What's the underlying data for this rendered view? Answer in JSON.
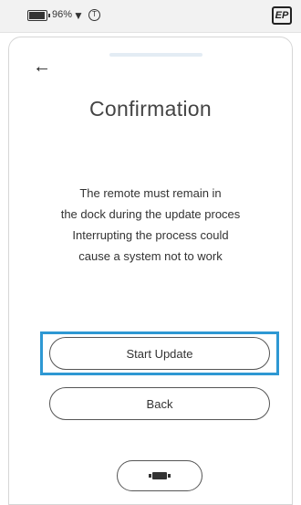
{
  "status_bar": {
    "battery_percent": "96%",
    "battery_icon": "battery-icon",
    "wifi_icon": "wifi-icon",
    "circle_icon": "circle-t-icon",
    "logo_text": "EP"
  },
  "screen": {
    "back_icon": "back-arrow-icon",
    "title": "Confirmation",
    "message_lines": [
      "The remote must remain in",
      "the dock during the update proces",
      "Interrupting the process could",
      "cause a system not to work"
    ],
    "start_button": "Start Update",
    "back_button": "Back",
    "dock_icon": "remote-dock-icon"
  },
  "colors": {
    "highlight": "#2e98d3",
    "status_bar_bg": "#f2f2f2"
  }
}
